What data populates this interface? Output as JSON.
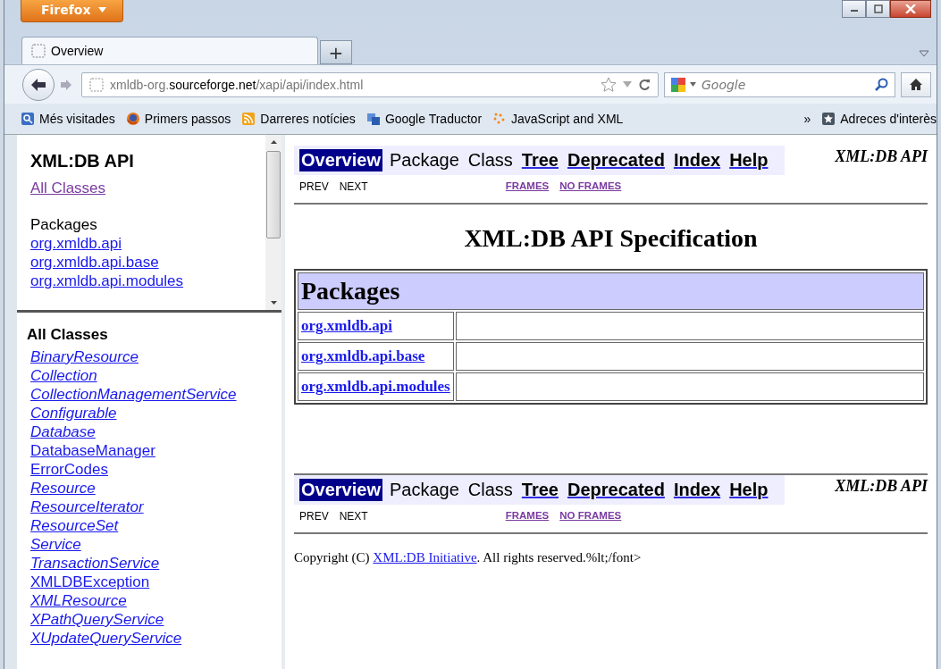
{
  "browser": {
    "menu_button": "Firefox",
    "tabs": [
      {
        "title": "Overview",
        "selected": true
      }
    ],
    "new_tab": "+",
    "url": {
      "prefix": "xmldb-org.",
      "domain": "sourceforge.net",
      "path": "/xapi/api/index.html"
    },
    "search": {
      "placeholder": "Google"
    },
    "bookmarks": [
      {
        "label": "Més visitades",
        "kind": "page"
      },
      {
        "label": "Primers passos",
        "kind": "fox"
      },
      {
        "label": "Darreres notícies",
        "kind": "feed"
      },
      {
        "label": "Google Traductor",
        "kind": "translate"
      },
      {
        "label": "JavaScript and XML",
        "kind": "dots"
      }
    ],
    "more_bookmarks": "»",
    "bookmarks_menu": "Adreces d'interès"
  },
  "packages_frame": {
    "title": "XML:DB API",
    "all_classes": {
      "label": "All Classes",
      "visited": true
    },
    "heading": "Packages",
    "packages": [
      "org.xmldb.api",
      "org.xmldb.api.base",
      "org.xmldb.api.modules"
    ]
  },
  "classes_frame": {
    "heading": "All Classes",
    "classes": [
      {
        "name": "BinaryResource",
        "kind": "interface"
      },
      {
        "name": "Collection",
        "kind": "interface"
      },
      {
        "name": "CollectionManagementService",
        "kind": "interface"
      },
      {
        "name": "Configurable",
        "kind": "interface"
      },
      {
        "name": "Database",
        "kind": "interface"
      },
      {
        "name": "DatabaseManager",
        "kind": "class"
      },
      {
        "name": "ErrorCodes",
        "kind": "class"
      },
      {
        "name": "Resource",
        "kind": "interface"
      },
      {
        "name": "ResourceIterator",
        "kind": "interface"
      },
      {
        "name": "ResourceSet",
        "kind": "interface"
      },
      {
        "name": "Service",
        "kind": "interface"
      },
      {
        "name": "TransactionService",
        "kind": "interface"
      },
      {
        "name": "XMLDBException",
        "kind": "class"
      },
      {
        "name": "XMLResource",
        "kind": "interface"
      },
      {
        "name": "XPathQueryService",
        "kind": "interface"
      },
      {
        "name": "XUpdateQueryService",
        "kind": "interface"
      }
    ]
  },
  "main": {
    "nav_bars": [
      {
        "items": [
          {
            "label": "Overview",
            "kind": "current"
          },
          {
            "label": "Package",
            "kind": "plain"
          },
          {
            "label": "Class",
            "kind": "plain"
          },
          {
            "label": "Tree",
            "kind": "link"
          },
          {
            "label": "Deprecated",
            "kind": "link"
          },
          {
            "label": "Index",
            "kind": "link"
          },
          {
            "label": "Help",
            "kind": "link"
          }
        ],
        "brand": "XML:DB API",
        "prev": "PREV",
        "next": "NEXT",
        "frames": "FRAMES",
        "no_frames": "NO FRAMES"
      },
      {
        "items": [
          {
            "label": "Overview",
            "kind": "current"
          },
          {
            "label": "Package",
            "kind": "plain"
          },
          {
            "label": "Class",
            "kind": "plain"
          },
          {
            "label": "Tree",
            "kind": "link"
          },
          {
            "label": "Deprecated",
            "kind": "link"
          },
          {
            "label": "Index",
            "kind": "link"
          },
          {
            "label": "Help",
            "kind": "link"
          }
        ],
        "brand": "XML:DB API",
        "prev": "PREV",
        "next": "NEXT",
        "frames": "FRAMES",
        "no_frames": "NO FRAMES"
      }
    ],
    "title": "XML:DB API Specification",
    "table": {
      "heading": "Packages",
      "rows": [
        "org.xmldb.api",
        "org.xmldb.api.base",
        "org.xmldb.api.modules"
      ]
    },
    "copyright": {
      "before": "Copyright (C) ",
      "link": "XML:DB Initiative",
      "after": ". All rights reserved.%lt;/font>"
    }
  }
}
